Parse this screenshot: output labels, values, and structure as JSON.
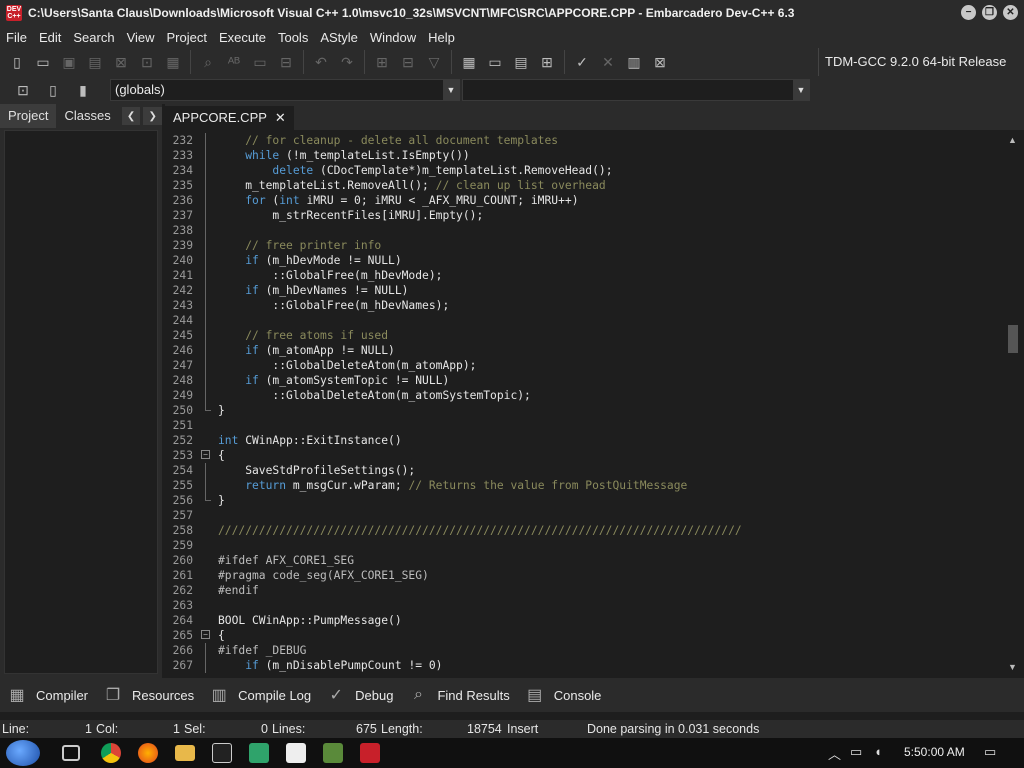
{
  "window": {
    "icon_label": "DEV C++",
    "title": "C:\\Users\\Santa Claus\\Downloads\\Microsoft Visual C++ 1.0\\msvc10_32s\\MSVCNT\\MFC\\SRC\\APPCORE.CPP - Embarcadero Dev-C++ 6.3",
    "minimize_glyph": "−",
    "maximize_glyph": "❐",
    "close_glyph": "✕"
  },
  "menu": [
    "File",
    "Edit",
    "Search",
    "View",
    "Project",
    "Execute",
    "Tools",
    "AStyle",
    "Window",
    "Help"
  ],
  "toolbar": {
    "compiler": "TDM-GCC 9.2.0 64-bit Release",
    "scope_select": "(globals)",
    "function_select": ""
  },
  "left_panel": {
    "tabs": [
      "Project",
      "Classes"
    ],
    "prev_arrow": "❮",
    "next_arrow": "❯"
  },
  "editor": {
    "tab_label": "APPCORE.CPP",
    "tab_close": "✕",
    "lines": [
      {
        "n": "232",
        "t": "    // for cleanup - delete all document templates",
        "c": "comment",
        "f": "line"
      },
      {
        "n": "233",
        "t": "    while (!m_templateList.IsEmpty())",
        "c": "",
        "f": "line"
      },
      {
        "n": "234",
        "t": "        delete (CDocTemplate*)m_templateList.RemoveHead();",
        "c": "",
        "f": "line"
      },
      {
        "n": "235",
        "t": "    m_templateList.RemoveAll(); // clean up list overhead",
        "c": "",
        "f": "line"
      },
      {
        "n": "236",
        "t": "    for (int iMRU = 0; iMRU < _AFX_MRU_COUNT; iMRU++)",
        "c": "",
        "f": "line"
      },
      {
        "n": "237",
        "t": "        m_strRecentFiles[iMRU].Empty();",
        "c": "",
        "f": "line"
      },
      {
        "n": "238",
        "t": "",
        "c": "",
        "f": "line"
      },
      {
        "n": "239",
        "t": "    // free printer info",
        "c": "comment",
        "f": "line"
      },
      {
        "n": "240",
        "t": "    if (m_hDevMode != NULL)",
        "c": "",
        "f": "line"
      },
      {
        "n": "241",
        "t": "        ::GlobalFree(m_hDevMode);",
        "c": "",
        "f": "line"
      },
      {
        "n": "242",
        "t": "    if (m_hDevNames != NULL)",
        "c": "",
        "f": "line"
      },
      {
        "n": "243",
        "t": "        ::GlobalFree(m_hDevNames);",
        "c": "",
        "f": "line"
      },
      {
        "n": "244",
        "t": "",
        "c": "",
        "f": "line"
      },
      {
        "n": "245",
        "t": "    // free atoms if used",
        "c": "comment",
        "f": "line"
      },
      {
        "n": "246",
        "t": "    if (m_atomApp != NULL)",
        "c": "",
        "f": "line"
      },
      {
        "n": "247",
        "t": "        ::GlobalDeleteAtom(m_atomApp);",
        "c": "",
        "f": "line"
      },
      {
        "n": "248",
        "t": "    if (m_atomSystemTopic != NULL)",
        "c": "",
        "f": "line"
      },
      {
        "n": "249",
        "t": "        ::GlobalDeleteAtom(m_atomSystemTopic);",
        "c": "",
        "f": "line"
      },
      {
        "n": "250",
        "t": "}",
        "c": "",
        "f": "end"
      },
      {
        "n": "251",
        "t": "",
        "c": "",
        "f": ""
      },
      {
        "n": "252",
        "t": "int CWinApp::ExitInstance()",
        "c": "",
        "f": ""
      },
      {
        "n": "253",
        "t": "{",
        "c": "",
        "f": "box"
      },
      {
        "n": "254",
        "t": "    SaveStdProfileSettings();",
        "c": "",
        "f": "line"
      },
      {
        "n": "255",
        "t": "    return m_msgCur.wParam; // Returns the value from PostQuitMessage",
        "c": "",
        "f": "line"
      },
      {
        "n": "256",
        "t": "}",
        "c": "",
        "f": "end"
      },
      {
        "n": "257",
        "t": "",
        "c": "",
        "f": ""
      },
      {
        "n": "258",
        "t": "/////////////////////////////////////////////////////////////////////////////",
        "c": "comment",
        "f": ""
      },
      {
        "n": "259",
        "t": "",
        "c": "",
        "f": ""
      },
      {
        "n": "260",
        "t": "#ifdef AFX_CORE1_SEG",
        "c": "pp",
        "f": ""
      },
      {
        "n": "261",
        "t": "#pragma code_seg(AFX_CORE1_SEG)",
        "c": "pp",
        "f": ""
      },
      {
        "n": "262",
        "t": "#endif",
        "c": "pp",
        "f": ""
      },
      {
        "n": "263",
        "t": "",
        "c": "",
        "f": ""
      },
      {
        "n": "264",
        "t": "BOOL CWinApp::PumpMessage()",
        "c": "",
        "f": ""
      },
      {
        "n": "265",
        "t": "{",
        "c": "",
        "f": "box"
      },
      {
        "n": "266",
        "t": "#ifdef _DEBUG",
        "c": "pp",
        "f": "line"
      },
      {
        "n": "267",
        "t": "    if (m_nDisablePumpCount != 0)",
        "c": "",
        "f": "line"
      }
    ]
  },
  "bottom_tabs": [
    {
      "label": "Compiler",
      "icon": "▦"
    },
    {
      "label": "Resources",
      "icon": "❐"
    },
    {
      "label": "Compile Log",
      "icon": "▥"
    },
    {
      "label": "Debug",
      "icon": "✓"
    },
    {
      "label": "Find Results",
      "icon": "⌕"
    },
    {
      "label": "Console",
      "icon": "▤"
    }
  ],
  "status": {
    "line_label": "Line:",
    "line_value": "1",
    "col_label": "Col:",
    "col_value": "1",
    "sel_label": "Sel:",
    "sel_value": "0",
    "lines_label": "Lines:",
    "lines_value": "675",
    "length_label": "Length:",
    "length_value": "18754",
    "mode": "Insert",
    "message": "Done parsing in 0.031 seconds"
  },
  "taskbar": {
    "clock": "5:50:00 AM",
    "tray_chevron": "︿",
    "notification_glyph": "▭"
  },
  "colors": {
    "background": "#1e1e1e",
    "chrome": "#2b2b2b",
    "keyword": "#569cd6",
    "comment": "#8a8a5c",
    "app_icon": "#c8202a"
  }
}
